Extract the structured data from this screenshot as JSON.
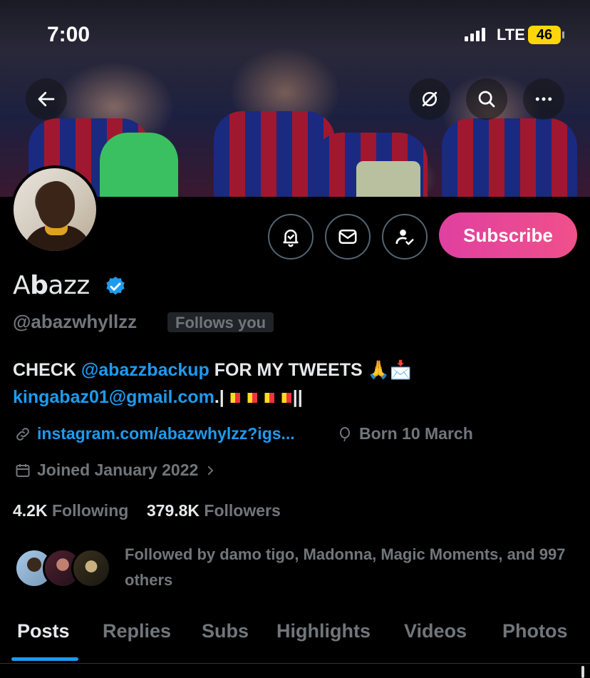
{
  "status_bar": {
    "time": "7:00",
    "network": "LTE",
    "battery": "46"
  },
  "profile": {
    "name_prefix": "A",
    "name_bold": "b",
    "name_suffix": "azz",
    "handle": "@abazwhyllzz",
    "follows_you": "Follows you",
    "subscribe_label": "Subscribe",
    "bio_check": "CHECK ",
    "bio_mention": "@abazzbackup",
    "bio_rest": " FOR MY TWEETS 🙏📩",
    "bio_email": "kingabaz01@gmail.com",
    "bio_sep": ".|",
    "bio_end": "||",
    "link": "instagram.com/abazwhylzz?igs...",
    "born": "Born 10 March",
    "joined": "Joined January 2022",
    "following_count": "4.2K",
    "following_label": "Following",
    "followers_count": "379.8K",
    "followers_label": "Followers",
    "followed_by": "Followed by damo tigo, Madonna, Magic Moments, and 997 others"
  },
  "tabs": [
    "Posts",
    "Replies",
    "Subs",
    "Highlights",
    "Videos",
    "Photos"
  ],
  "colors": {
    "accent": "#1d9bf0",
    "subscribe_start": "#e040a0",
    "subscribe_end": "#f0508a",
    "verified": "#1d9bf0"
  }
}
